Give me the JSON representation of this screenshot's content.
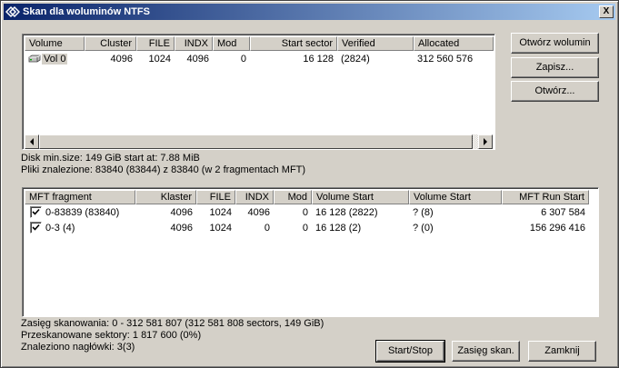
{
  "window": {
    "title": "Skan dla woluminów NTFS",
    "close_label": "X"
  },
  "volumes": {
    "columns": [
      "Volume",
      "Cluster",
      "FILE",
      "INDX",
      "Mod",
      "Start sector",
      "Verified",
      "Allocated"
    ],
    "rows": [
      {
        "volume": "Vol 0",
        "cluster": "4096",
        "file": "1024",
        "indx": "4096",
        "mod": "0",
        "start_sector": "16 128",
        "verified": "(2824)",
        "allocated": "312 560 576"
      }
    ]
  },
  "info": {
    "disk_min_size": "Disk min.size: 149 GiB start at: 7.88 MiB",
    "files_found": "Pliki znalezione: 83840 (83844) z 83840 (w 2 fragmentach MFT)"
  },
  "mft": {
    "columns": [
      "MFT fragment",
      "Klaster",
      "FILE",
      "INDX",
      "Mod",
      "Volume Start",
      "Volume Start",
      "MFT Run Start"
    ],
    "rows": [
      {
        "checked": true,
        "fragment": "0-83839 (83840)",
        "klaster": "4096",
        "file": "1024",
        "indx": "4096",
        "mod": "0",
        "volume_start": "16 128 (2822)",
        "volume_start2": "? (8)",
        "mft_run_start": "6 307 584"
      },
      {
        "checked": true,
        "fragment": "0-3 (4)",
        "klaster": "4096",
        "file": "1024",
        "indx": "0",
        "mod": "0",
        "volume_start": "16 128 (2)",
        "volume_start2": "? (0)",
        "mft_run_start": "156 296 416"
      }
    ]
  },
  "status": {
    "scan_range": "Zasięg skanowania: 0 - 312 581 807 (312 581 808 sectors, 149 GiB)",
    "scanned_sectors": "Przeskanowane sektory: 1 817 600 (0%)",
    "headers_found": "Znaleziono nagłówki: 3(3)"
  },
  "buttons": {
    "open_volume": "Otwórz wolumin",
    "save": "Zapisz...",
    "open": "Otwórz...",
    "start_stop": "Start/Stop",
    "scan_range": "Zasięg skan.",
    "close": "Zamknij"
  },
  "icons": {
    "app": "app-icon",
    "disk": "disk-icon",
    "check": "check-icon"
  },
  "colors": {
    "titlebar_start": "#0a246a",
    "titlebar_end": "#a6caf0",
    "face": "#d4d0c8"
  }
}
